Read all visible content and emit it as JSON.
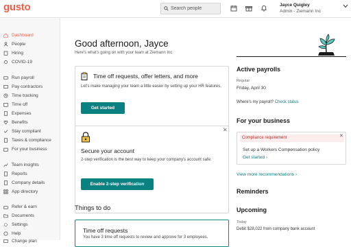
{
  "topbar": {
    "logo": "gusto",
    "search_placeholder": "Search people",
    "user_name": "Jayce Quigley",
    "user_role": "Admin - Ziemann Inc"
  },
  "sidebar": {
    "items": [
      {
        "label": "Dashboard",
        "icon": "home-icon",
        "active": true
      },
      {
        "label": "People",
        "icon": "people-icon"
      },
      {
        "label": "Hiring",
        "icon": "clipboard-icon"
      },
      {
        "label": "COVID-19",
        "icon": "covid-icon"
      },
      {
        "label": "Run payroll",
        "icon": "payroll-icon"
      },
      {
        "label": "Pay contractors",
        "icon": "contractor-icon"
      },
      {
        "label": "Time tracking",
        "icon": "clock-icon"
      },
      {
        "label": "Time off",
        "icon": "calendar-icon"
      },
      {
        "label": "Expenses",
        "icon": "receipt-icon"
      },
      {
        "label": "Benefits",
        "icon": "heart-icon"
      },
      {
        "label": "Stay compliant",
        "icon": "check-icon"
      },
      {
        "label": "Taxes & compliance",
        "icon": "document-icon"
      },
      {
        "label": "For your business",
        "icon": "briefcase-icon"
      },
      {
        "label": "Team insights",
        "icon": "insights-icon"
      },
      {
        "label": "Reports",
        "icon": "report-icon"
      },
      {
        "label": "Company details",
        "icon": "building-icon"
      },
      {
        "label": "App directory",
        "icon": "grid-icon"
      },
      {
        "label": "Refer & earn",
        "icon": "gift-icon"
      },
      {
        "label": "Documents",
        "icon": "folder-icon"
      },
      {
        "label": "Settings",
        "icon": "gear-icon"
      },
      {
        "label": "Help",
        "icon": "help-icon"
      },
      {
        "label": "Change plan",
        "icon": "plan-icon"
      }
    ]
  },
  "main": {
    "greeting": "Good afternoon, Jayce",
    "subtitle": "Here's what's going on with your team at Ziemann Inc",
    "card1": {
      "title": "Time off requests, offer letters, and more",
      "body": "Let's make managing your team a little easier by setting up your HR features.",
      "button": "Get started"
    },
    "card2": {
      "title": "Secure your account",
      "body": "2-step verification is the best way to keep your company's account safe.",
      "button": "Enable 2-step verification"
    },
    "things_to_do": "Things to do",
    "todo": {
      "title": "Time off requests",
      "body": "You have 3 time off requests to review and approve for 3 employees."
    }
  },
  "right": {
    "active_payrolls": "Active payrolls",
    "regular_label": "Regular",
    "payroll_date": "Friday, April 30",
    "where_payroll": "Where's my payroll?",
    "check_status": "Check status",
    "for_business": "For your business",
    "compliance_badge": "Compliance requirement",
    "compliance_text": "Set up a Workers Compensation policy",
    "compliance_link": "Get started",
    "view_more": "View more recommendations",
    "reminders": "Reminders",
    "upcoming": "Upcoming",
    "today": "Today",
    "debit": "Debit $28,022 from company bank account"
  },
  "colors": {
    "brand": "#f45d48",
    "teal": "#0a8080",
    "sidebar_bg": "#f7f7f7"
  }
}
